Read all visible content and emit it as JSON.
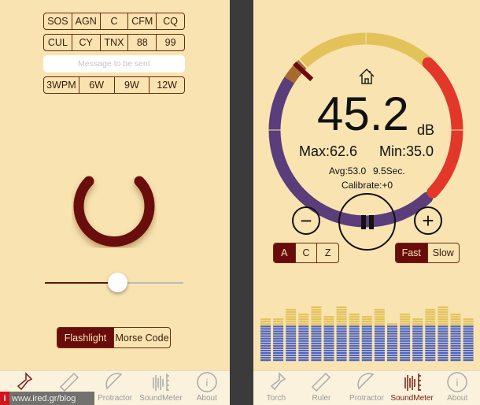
{
  "torch": {
    "morse_row1": [
      "SOS",
      "AGN",
      "C",
      "CFM",
      "CQ"
    ],
    "morse_row2": [
      "CUL",
      "CY",
      "TNX",
      "88",
      "99"
    ],
    "message_placeholder": "Message to be sent",
    "speed_options": [
      "3WPM",
      "6W",
      "9W",
      "12W"
    ],
    "brightness": 0.52,
    "mode_options": [
      "Flashlight",
      "Morse Code"
    ],
    "mode_selected": "Flashlight"
  },
  "soundmeter": {
    "value": "45.2",
    "unit": "dB",
    "max": "Max:62.6",
    "min": "Min:35.0",
    "avg": "Avg:53.0",
    "duration": "9.5Sec.",
    "calibrate": "Calibrate:+0",
    "weighting_options": [
      "A",
      "C",
      "Z"
    ],
    "weighting_selected": "A",
    "response_options": [
      "Fast",
      "Slow"
    ],
    "response_selected": "Fast",
    "spectrum_yellow_levels": [
      3,
      3,
      7,
      5,
      8,
      4,
      8,
      5,
      4,
      7,
      1,
      5,
      3,
      7,
      8,
      5,
      3
    ],
    "spectrum_blue_levels": 15
  },
  "tabs": [
    {
      "label": "Torch",
      "icon": "flashlight-icon"
    },
    {
      "label": "Ruler",
      "icon": "ruler-icon"
    },
    {
      "label": "Protractor",
      "icon": "protractor-icon"
    },
    {
      "label": "SoundMeter",
      "icon": "soundmeter-icon"
    },
    {
      "label": "About",
      "icon": "info-icon"
    }
  ],
  "watermark": "www.ired.gr/blog",
  "colors": {
    "background": "#f8e3b1",
    "accent": "#6a0c0c",
    "purple": "#5a3d7a",
    "yellow": "#e3c25a",
    "red": "#e2382a",
    "blue": "#4a63c4",
    "power_red": "#e5392a"
  }
}
